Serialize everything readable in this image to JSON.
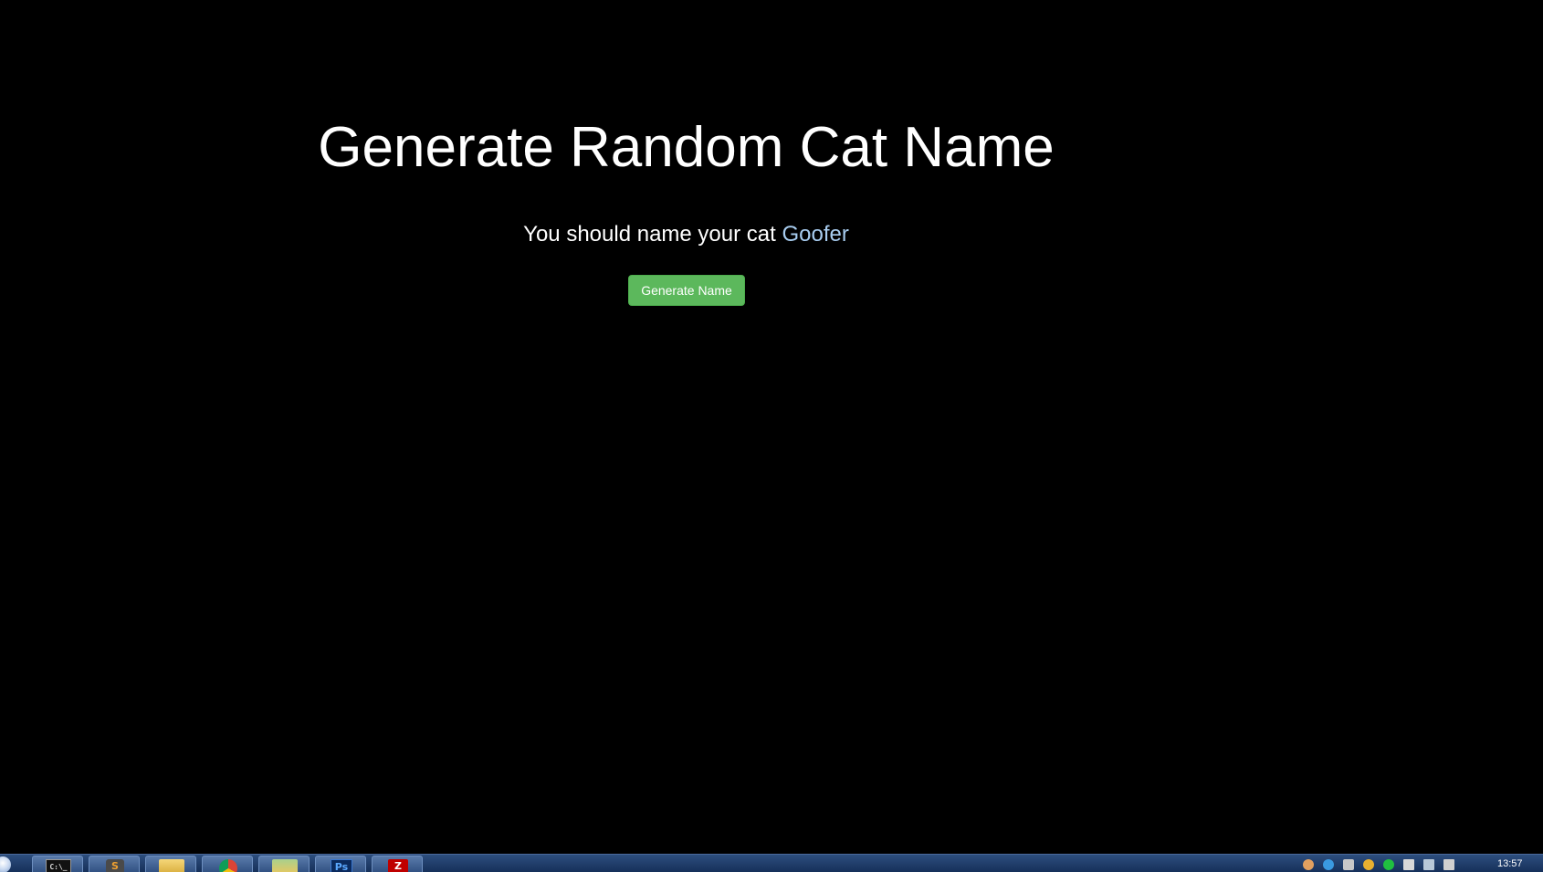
{
  "page": {
    "title": "Generate Random Cat Name",
    "subtitle_prefix": "You should name your cat",
    "cat_name": "Goofer",
    "button_label": "Generate Name"
  },
  "colors": {
    "background": "#000000",
    "text": "#ffffff",
    "cat_name": "#a8cdf0",
    "button": "#5cb85c"
  },
  "taskbar": {
    "apps": [
      {
        "name": "cmd-icon",
        "glyph": "C:\\_"
      },
      {
        "name": "sublime-text-icon",
        "glyph": "S"
      },
      {
        "name": "folder-icon",
        "glyph": ""
      },
      {
        "name": "chrome-icon",
        "glyph": ""
      },
      {
        "name": "windows-explorer-icon",
        "glyph": ""
      },
      {
        "name": "photoshop-icon",
        "glyph": "Ps"
      },
      {
        "name": "filezilla-icon",
        "glyph": "Z"
      }
    ],
    "clock": "13:57"
  }
}
